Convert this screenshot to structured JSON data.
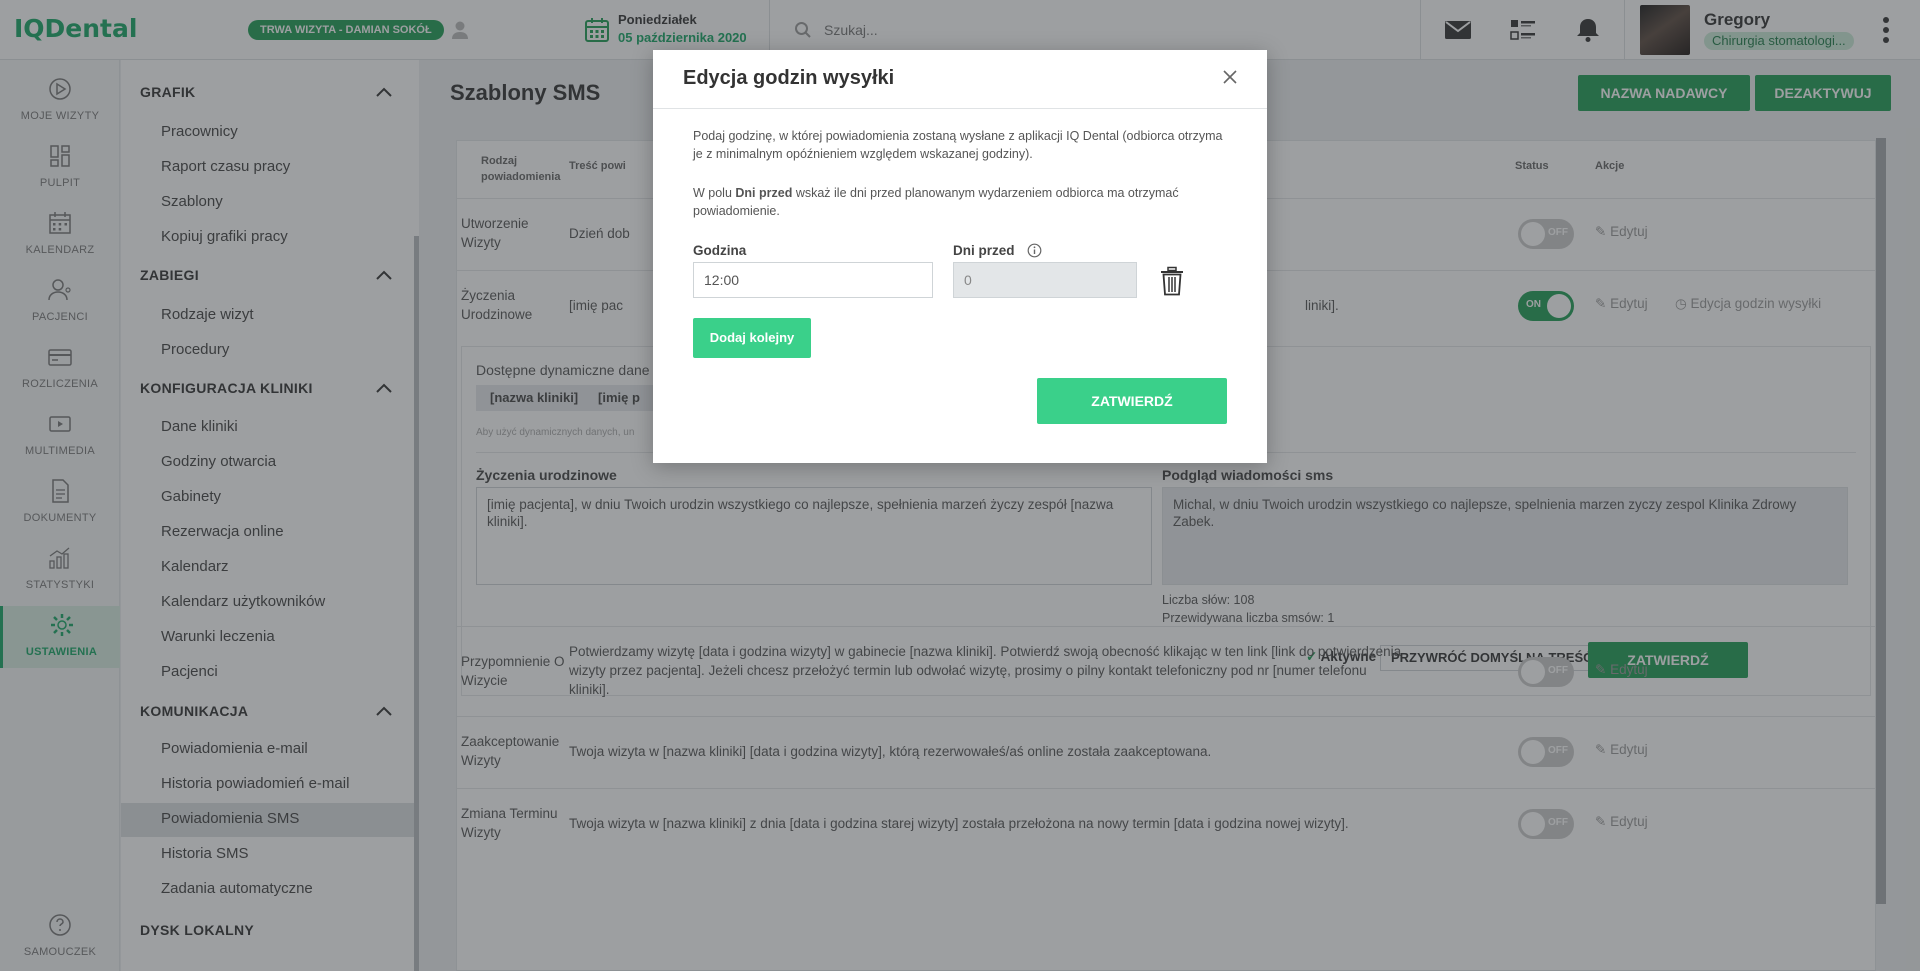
{
  "app": {
    "logo": "IQDental"
  },
  "topbar": {
    "visit_badge": "TRWA WIZYTA - DAMIAN SOKÓŁ",
    "date_day": "Poniedziałek",
    "date_full": "05 października 2020",
    "search_placeholder": "Szukaj...",
    "user_name": "Gregory",
    "user_role": "Chirurgia stomatologi..."
  },
  "icon_rail": [
    {
      "label": "MOJE WIZYTY",
      "icon": "play-circle-icon"
    },
    {
      "label": "PULPIT",
      "icon": "dashboard-icon"
    },
    {
      "label": "KALENDARZ",
      "icon": "calendar-icon"
    },
    {
      "label": "PACJENCI",
      "icon": "patients-icon"
    },
    {
      "label": "ROZLICZENIA",
      "icon": "card-icon"
    },
    {
      "label": "MULTIMEDIA",
      "icon": "media-icon"
    },
    {
      "label": "DOKUMENTY",
      "icon": "document-icon"
    },
    {
      "label": "STATYSTYKI",
      "icon": "stats-icon"
    },
    {
      "label": "USTAWIENIA",
      "icon": "settings-icon",
      "active": true
    },
    {
      "label": "SAMOUCZEK",
      "icon": "help-icon"
    }
  ],
  "submenu": {
    "sections": [
      {
        "title": "GRAFIK",
        "items": [
          "Pracownicy",
          "Raport czasu pracy",
          "Szablony",
          "Kopiuj grafiki pracy"
        ]
      },
      {
        "title": "ZABIEGI",
        "items": [
          "Rodzaje wizyt",
          "Procedury"
        ]
      },
      {
        "title": "KONFIGURACJA KLINIKI",
        "items": [
          "Dane kliniki",
          "Godziny otwarcia",
          "Gabinety",
          "Rezerwacja online",
          "Kalendarz",
          "Kalendarz użytkowników",
          "Warunki leczenia",
          "Pacjenci"
        ]
      },
      {
        "title": "KOMUNIKACJA",
        "items": [
          "Powiadomienia e-mail",
          "Historia powiadomień e-mail",
          "Powiadomienia SMS",
          "Historia SMS",
          "Zadania automatyczne"
        ]
      },
      {
        "title": "DYSK LOKALNY",
        "items": []
      }
    ],
    "active_item": "Powiadomienia SMS"
  },
  "main": {
    "title": "Szablony SMS",
    "btn_sender": "NAZWA NADAWCY",
    "btn_deactivate": "DEZAKTYWUJ",
    "headers": {
      "type": "Rodzaj powiadomienia",
      "content": "Treść powi",
      "status": "Status",
      "actions": "Akcje"
    },
    "rows": [
      {
        "type": "Utworzenie Wizyty",
        "text": "Dzień dob",
        "status": "OFF",
        "edit": "Edytuj"
      },
      {
        "type": "Życzenia Urodzinowe",
        "text": "[imię pac",
        "text_tail": "liniki].",
        "status": "ON",
        "edit": "Edytuj",
        "extra": "Edycja godzin wysyłki"
      },
      {
        "type": "Przypomnienie O Wizycie",
        "text1": "Potwierdzamy wizytę [data i godzina wizyty] w gabinecie [nazwa kliniki]. Potwierdź swoją obecność klikając w ten link [link do potwierdzenia",
        "text2": "wizyty przez pacjenta]. Jeżeli chcesz przełożyć termin lub odwołać wizytę, prosimy o pilny kontakt telefoniczny pod nr [numer telefonu",
        "text3": "kliniki].",
        "status": "OFF",
        "edit": "Edytuj"
      },
      {
        "type": "Zaakceptowanie Wizyty",
        "text": "Twoja wizyta w [nazwa kliniki] [data i godzina wizyty], którą rezerwowałeś/aś online została zaakceptowana.",
        "status": "OFF",
        "edit": "Edytuj"
      },
      {
        "type": "Zmiana Terminu Wizyty",
        "text": "Twoja wizyta w [nazwa kliniki] z dnia [data i godzina starej wizyty] została przełożona na nowy termin [data i godzina nowej wizyty].",
        "status": "OFF",
        "edit": "Edytuj"
      }
    ],
    "expanded": {
      "dyn_title": "Dostępne dynamiczne dane",
      "chips": [
        "[nazwa kliniki]",
        "[imię p"
      ],
      "dyn_hint": "Aby użyć dynamicznych danych, un",
      "template_label": "Życzenia urodzinowe",
      "template_text": "[imię pacjenta], w dniu Twoich urodzin wszystkiego co najlepsze, spełnienia marzeń życzy zespół [nazwa kliniki].",
      "preview_label": "Podgląd wiadomości sms",
      "preview_text": "Michal, w dniu Twoich urodzin wszystkiego co najlepsze, spelnienia marzen zyczy zespol Klinika Zdrowy Zabek.",
      "word_count": "Liczba słów: 108",
      "sms_count": "Przewidywana liczba smsów: 1",
      "active_label": "Aktywne",
      "restore_btn": "PRZYWRÓĆ DOMYŚLNĄ TREŚĆ",
      "confirm_btn": "ZATWIERDŹ"
    }
  },
  "modal": {
    "title": "Edycja godzin wysyłki",
    "para1": "Podaj godzinę, w której powiadomienia zostaną wysłane z aplikacji IQ Dental (odbiorca otrzyma je z minimalnym opóźnieniem względem wskazanej godziny).",
    "para2_a": "W polu ",
    "para2_b": "Dni przed",
    "para2_c": " wskaż ile dni przed planowanym wydarzeniem odbiorca ma otrzymać powiadomienie.",
    "hour_label": "Godzina",
    "hour_value": "12:00",
    "days_label": "Dni przed",
    "days_value": "0",
    "add_btn": "Dodaj kolejny",
    "confirm_btn": "ZATWIERDŹ"
  },
  "colors": {
    "brand": "#17a866",
    "button": "#1f9e55",
    "modal_button": "#3ad08a"
  }
}
